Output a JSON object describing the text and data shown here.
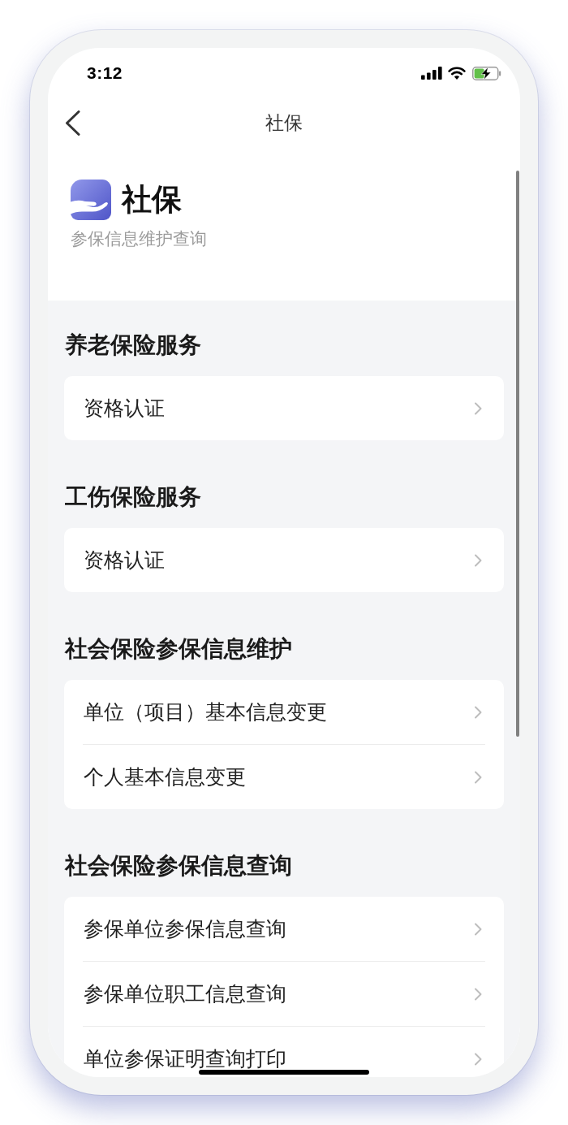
{
  "status_bar": {
    "time": "3:12"
  },
  "nav_bar": {
    "title": "社保"
  },
  "header": {
    "title": "社保",
    "subtitle": "参保信息维护查询"
  },
  "sections": [
    {
      "title": "养老保险服务",
      "items": [
        {
          "label": "资格认证"
        }
      ]
    },
    {
      "title": "工伤保险服务",
      "items": [
        {
          "label": "资格认证"
        }
      ]
    },
    {
      "title": "社会保险参保信息维护",
      "items": [
        {
          "label": "单位（项目）基本信息变更"
        },
        {
          "label": "个人基本信息变更"
        }
      ]
    },
    {
      "title": "社会保险参保信息查询",
      "items": [
        {
          "label": "参保单位参保信息查询"
        },
        {
          "label": "参保单位职工信息查询"
        },
        {
          "label": "单位参保证明查询打印"
        }
      ]
    }
  ]
}
